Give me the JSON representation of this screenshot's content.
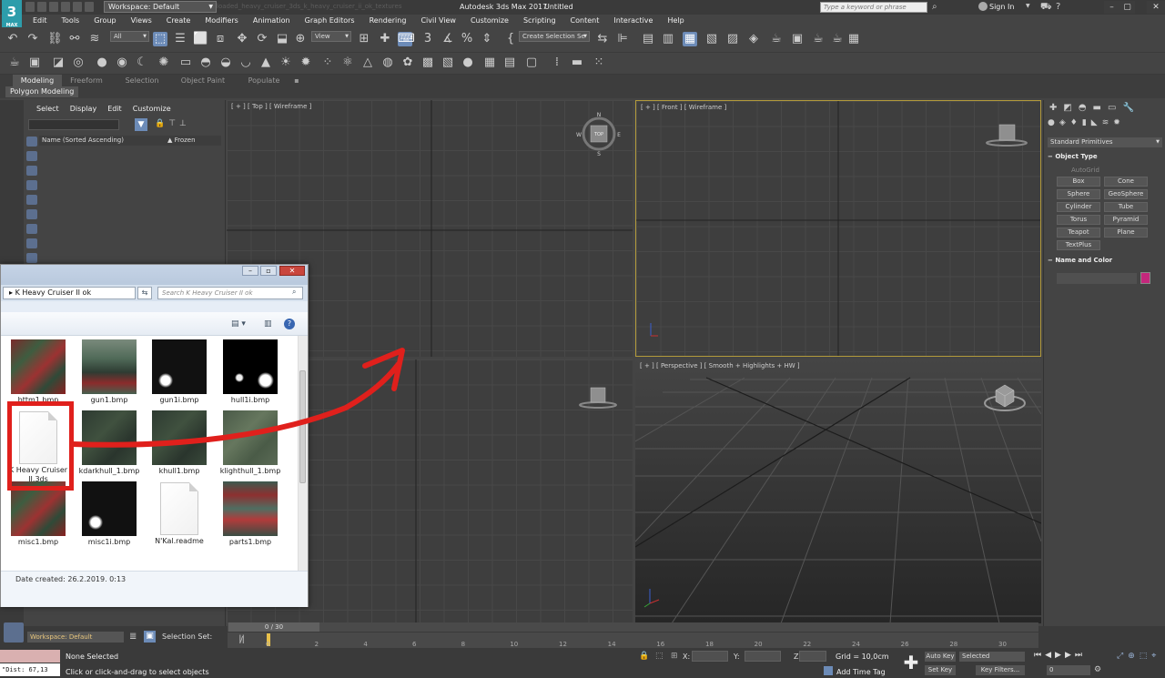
{
  "window": {
    "title": "Autodesk 3ds Max 2017",
    "file": "Untitled",
    "title_faint": "loaded_heavy_cruiser_3ds_k_heavy_cruiser_ii_ok_textures",
    "workspace": "Workspace: Default",
    "search_placeholder": "Type a keyword or phrase",
    "sign_in": "Sign In",
    "logo": "3",
    "logo_sub": "MAX"
  },
  "menu": [
    "Edit",
    "Tools",
    "Group",
    "Views",
    "Create",
    "Modifiers",
    "Animation",
    "Graph Editors",
    "Rendering",
    "Civil View",
    "Customize",
    "Scripting",
    "Content",
    "Interactive",
    "Help"
  ],
  "toolbar": {
    "filter": "All",
    "ref_coord": "View",
    "selection_set": "Create Selection Se"
  },
  "ribbon": {
    "tabs": [
      "Modeling",
      "Freeform",
      "Selection",
      "Object Paint",
      "Populate"
    ],
    "active_tab": "Modeling",
    "panel_label": "Polygon Modeling"
  },
  "scene_explorer": {
    "menu": [
      "Select",
      "Display",
      "Edit",
      "Customize"
    ],
    "col_name": "Name (Sorted Ascending)",
    "col_frozen": "▲ Frozen"
  },
  "viewports": {
    "top": "[ + ] [ Top ] [ Wireframe ]",
    "front": "[ + ] [ Front ] [ Wireframe ]",
    "perspective": "[ + ] [ Perspective ] [ Smooth + Highlights + HW ]"
  },
  "viewcube": {
    "n": "N",
    "s": "S",
    "e": "E",
    "w": "W",
    "top": "TOP"
  },
  "command_panel": {
    "category": "Standard Primitives",
    "object_type_title": "Object Type",
    "autogrid": "AutoGrid",
    "primitives": [
      "Box",
      "Cone",
      "Sphere",
      "GeoSphere",
      "Cylinder",
      "Tube",
      "Torus",
      "Pyramid",
      "Teapot",
      "Plane",
      "TextPlus"
    ],
    "name_color_title": "Name and Color",
    "object_color": "#c4277c"
  },
  "explorer": {
    "address": "K Heavy Cruiser II ok",
    "search_placeholder": "Search K Heavy Cruiser II ok",
    "files": [
      {
        "name": "bttm1.bmp",
        "kind": "texture-red"
      },
      {
        "name": "gun1.bmp",
        "kind": "texture-gun"
      },
      {
        "name": "gun1i.bmp",
        "kind": "texture-black"
      },
      {
        "name": "hull1i.bmp",
        "kind": "texture-hulli"
      },
      {
        "name": "K Heavy Cruiser II.3ds",
        "kind": "doc"
      },
      {
        "name": "kdarkhull_1.bmp",
        "kind": "texture-hull"
      },
      {
        "name": "khull1.bmp",
        "kind": "texture-hull"
      },
      {
        "name": "klighthull_1.bmp",
        "kind": "texture-hulllight"
      },
      {
        "name": "misc1.bmp",
        "kind": "texture-red"
      },
      {
        "name": "misc1i.bmp",
        "kind": "texture-black"
      },
      {
        "name": "N'Kal.readme",
        "kind": "doc"
      },
      {
        "name": "parts1.bmp",
        "kind": "texture-parts"
      }
    ],
    "status": "Date created: 26.2.2019. 0:13"
  },
  "highlight_color": "#e0201c",
  "bottom": {
    "workspace": "Workspace: Default",
    "selection_set_label": "Selection Set:",
    "time_position": "0 / 30",
    "ticks": [
      "0",
      "2",
      "4",
      "6",
      "8",
      "10",
      "12",
      "14",
      "16",
      "18",
      "20",
      "22",
      "24",
      "26",
      "28",
      "30"
    ],
    "maxscript": "\"Dist: 67,13",
    "status_selected": "None Selected",
    "status_prompt": "Click or click-and-drag to select objects",
    "x_label": "X:",
    "y_label": "Y:",
    "z_label": "Z:",
    "grid": "Grid = 10,0cm",
    "add_time_tag": "Add Time Tag",
    "auto_key": "Auto Key",
    "set_key": "Set Key",
    "selected": "Selected",
    "key_filters": "Key Filters...",
    "frame": "0"
  }
}
